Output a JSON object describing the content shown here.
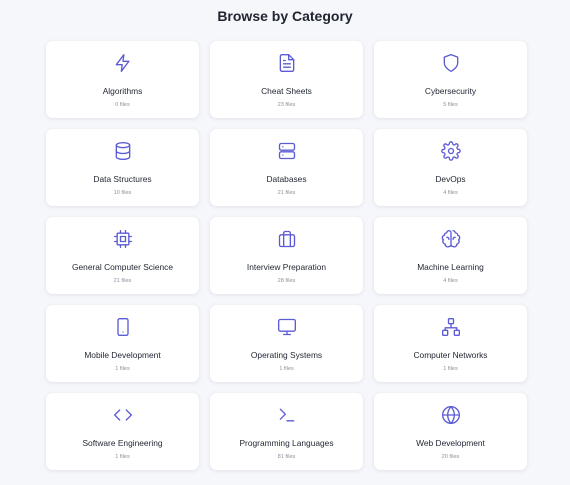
{
  "page": {
    "title": "Browse by Category"
  },
  "accent_color": "#5b5bd6",
  "categories": [
    {
      "name": "Algorithms",
      "count": "0 files",
      "icon": "lightning-icon"
    },
    {
      "name": "Cheat Sheets",
      "count": "23 files",
      "icon": "document-icon"
    },
    {
      "name": "Cybersecurity",
      "count": "5 files",
      "icon": "shield-icon"
    },
    {
      "name": "Data Structures",
      "count": "10 files",
      "icon": "database-icon"
    },
    {
      "name": "Databases",
      "count": "21 files",
      "icon": "server-icon"
    },
    {
      "name": "DevOps",
      "count": "4 files",
      "icon": "gear-icon"
    },
    {
      "name": "General Computer Science",
      "count": "21 files",
      "icon": "cpu-icon"
    },
    {
      "name": "Interview Preparation",
      "count": "28 files",
      "icon": "briefcase-icon"
    },
    {
      "name": "Machine Learning",
      "count": "4 files",
      "icon": "brain-icon"
    },
    {
      "name": "Mobile Development",
      "count": "1 files",
      "icon": "smartphone-icon"
    },
    {
      "name": "Operating Systems",
      "count": "1 files",
      "icon": "monitor-icon"
    },
    {
      "name": "Computer Networks",
      "count": "1 files",
      "icon": "network-icon"
    },
    {
      "name": "Software Engineering",
      "count": "1 files",
      "icon": "code-icon"
    },
    {
      "name": "Programming Languages",
      "count": "81 files",
      "icon": "terminal-icon"
    },
    {
      "name": "Web Development",
      "count": "20 files",
      "icon": "globe-icon"
    }
  ]
}
